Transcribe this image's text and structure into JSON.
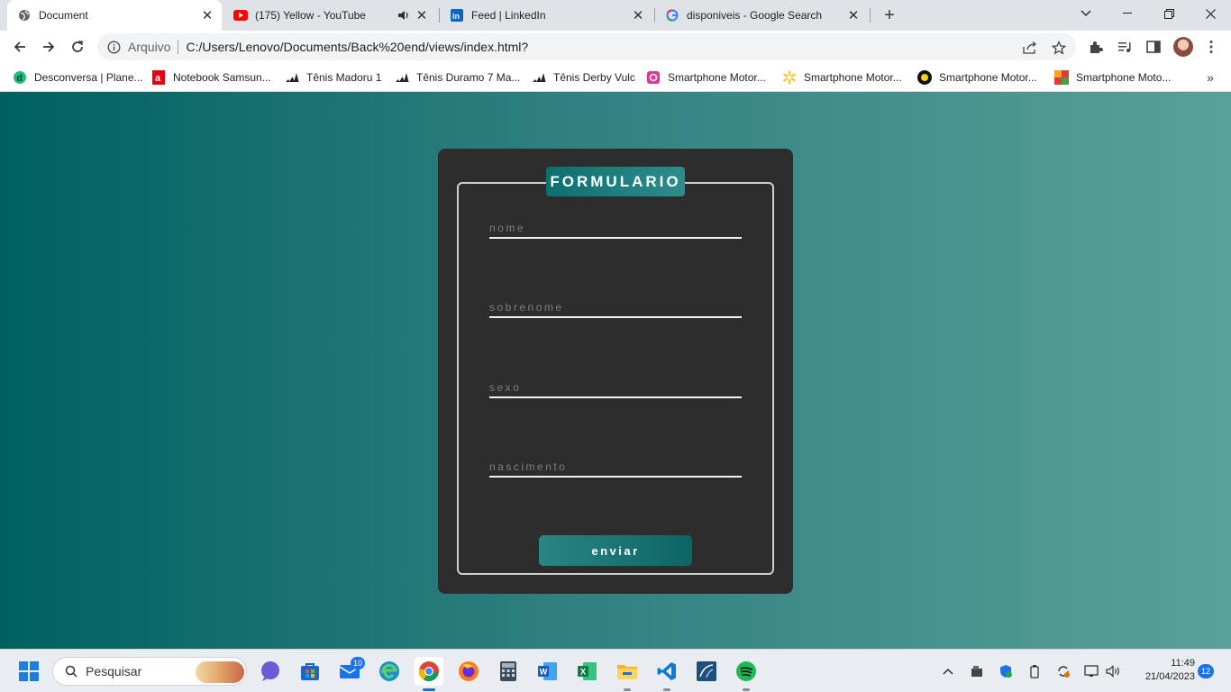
{
  "browser": {
    "tabs": [
      {
        "title": "Document",
        "icon": "globe-icon",
        "active": true
      },
      {
        "title": "(175) Yellow - YouTube",
        "icon": "youtube-icon",
        "audio": true
      },
      {
        "title": "Feed | LinkedIn",
        "icon": "linkedin-icon"
      },
      {
        "title": "disponiveis - Google Search",
        "icon": "google-icon"
      }
    ],
    "address": {
      "scheme_label": "Arquivo",
      "url": "C:/Users/Lenovo/Documents/Back%20end/views/index.html?"
    },
    "bookmarks": [
      {
        "label": "Desconversa | Plane...",
        "icon": "desconversa-icon"
      },
      {
        "label": "Notebook Samsun...",
        "icon": "americanas-icon"
      },
      {
        "label": "Tênis Madoru 1",
        "icon": "adidas-icon"
      },
      {
        "label": "Tênis Duramo 7 Ma...",
        "icon": "adidas-icon"
      },
      {
        "label": "Tênis Derby Vulc",
        "icon": "adidas-icon"
      },
      {
        "label": "Smartphone Motor...",
        "icon": "shop-c-icon"
      },
      {
        "label": "Smartphone Motor...",
        "icon": "walmart-icon"
      },
      {
        "label": "Smartphone Motor...",
        "icon": "shop-black-icon"
      },
      {
        "label": "Smartphone Moto...",
        "icon": "shop-colorful-icon"
      }
    ]
  },
  "form": {
    "title": "FORMULARIO",
    "fields": [
      {
        "placeholder": "nome"
      },
      {
        "placeholder": "sobrenome"
      },
      {
        "placeholder": "sexo"
      },
      {
        "placeholder": "nascimento"
      }
    ],
    "submit_label": "enviar"
  },
  "taskbar": {
    "search_placeholder": "Pesquisar",
    "mail_badge": "10",
    "time": "11:49",
    "date": "21/04/2023",
    "notifications": "12"
  },
  "colors": {
    "page_gradient_start": "#006060",
    "page_gradient_end": "#5aa09a",
    "card_bg": "#2d2d2d",
    "accent": "#0e6f6f"
  }
}
